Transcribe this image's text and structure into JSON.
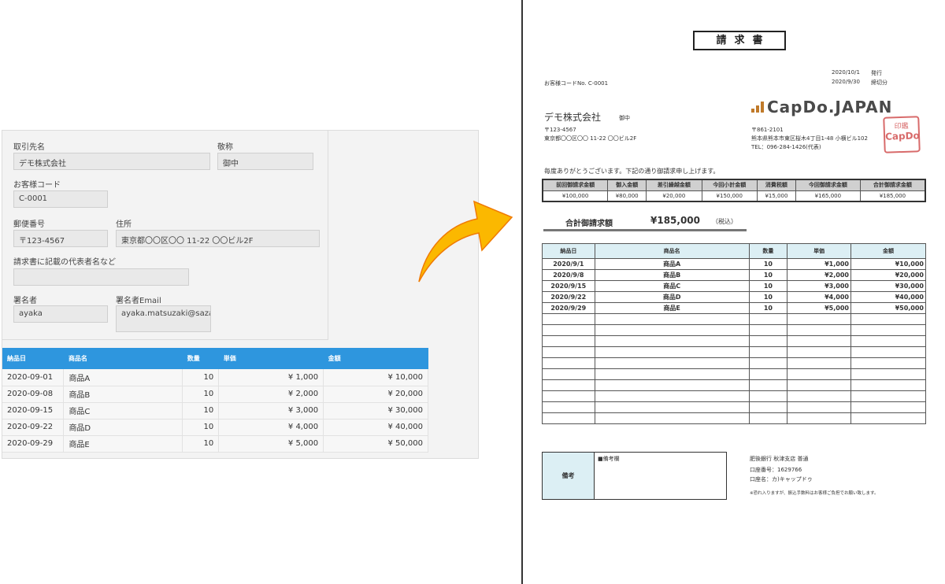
{
  "form": {
    "client_name_label": "取引先名",
    "client_name_value": "デモ株式会社",
    "honorific_label": "敬称",
    "honorific_value": "御中",
    "customer_code_label": "お客様コード",
    "customer_code_value": "C-0001",
    "postal_label": "郵便番号",
    "postal_value": "〒123-4567",
    "address_label": "住所",
    "address_value": "東京都〇〇区〇〇 11-22 〇〇ビル2F",
    "rep_label": "請求書に記載の代表者名など",
    "rep_value": "",
    "signer_label": "署名者",
    "signer_value": "ayaka",
    "signer_email_label": "署名者Email",
    "signer_email_value": "ayaka.matsuzaki@sazae.com.au"
  },
  "grid": {
    "headers": [
      "納品日",
      "商品名",
      "数量",
      "単価",
      "金額"
    ],
    "rows": [
      [
        "2020-09-01",
        "商品A",
        "10",
        "¥ 1,000",
        "¥ 10,000"
      ],
      [
        "2020-09-08",
        "商品B",
        "10",
        "¥ 2,000",
        "¥ 20,000"
      ],
      [
        "2020-09-15",
        "商品C",
        "10",
        "¥ 3,000",
        "¥ 30,000"
      ],
      [
        "2020-09-22",
        "商品D",
        "10",
        "¥ 4,000",
        "¥ 40,000"
      ],
      [
        "2020-09-29",
        "商品E",
        "10",
        "¥ 5,000",
        "¥ 50,000"
      ]
    ]
  },
  "colors": {
    "accent": "#2e96de",
    "arrow": "#fbb800",
    "logo": "#c07a2a",
    "stamp": "#d86b6b"
  },
  "invoice": {
    "title": "請求書",
    "issue_date": "2020/10/1",
    "issue_label": "発行",
    "cutoff_date": "2020/9/30",
    "cutoff_label": "締切分",
    "customer_code": "お客様コードNo.  C-0001",
    "client_name": "デモ株式会社",
    "client_honorific": "御中",
    "client_postal": "〒123-4567",
    "client_address": "東京都〇〇区〇〇 11-22 〇〇ビル2F",
    "logo_text": "CapDo.JAPAN",
    "sender_postal": "〒861-2101",
    "sender_address": "熊本県熊本市東区桜木4丁目1-48 小横ビル102",
    "sender_tel": "TEL：096-284-1426(代表)",
    "stamp_top": "印鑑",
    "stamp_text": "CapDo",
    "greeting": "毎度ありがとうございます。下記の通り御請求申し上げます。",
    "summary_headers": [
      "前回御請求金額",
      "御入金額",
      "差引繰越金額",
      "今回小計金額",
      "消費税額",
      "今回御請求金額",
      "合計御請求金額"
    ],
    "summary_values": [
      "¥100,000",
      "¥80,000",
      "¥20,000",
      "¥150,000",
      "¥15,000",
      "¥165,000",
      "¥185,000"
    ],
    "total_label": "合計御請求額",
    "total_value": "¥185,000",
    "total_tax": "（税込）",
    "item_headers": [
      "納品日",
      "商品名",
      "数量",
      "単価",
      "金額"
    ],
    "items": [
      [
        "2020/9/1",
        "商品A",
        "10",
        "¥1,000",
        "¥10,000"
      ],
      [
        "2020/9/8",
        "商品B",
        "10",
        "¥2,000",
        "¥20,000"
      ],
      [
        "2020/9/15",
        "商品C",
        "10",
        "¥3,000",
        "¥30,000"
      ],
      [
        "2020/9/22",
        "商品D",
        "10",
        "¥4,000",
        "¥40,000"
      ],
      [
        "2020/9/29",
        "商品E",
        "10",
        "¥5,000",
        "¥50,000"
      ]
    ],
    "remarks_label": "備考",
    "remarks_text": "■備考欄",
    "bank_name": "肥後銀行 秋津支店 普通",
    "bank_account": "口座番号：1629766",
    "bank_holder": "口座名：カ)キャップドゥ",
    "bank_note": "※恐れ入りますが、振込手数料はお客様ご負担でお願い致します。"
  }
}
